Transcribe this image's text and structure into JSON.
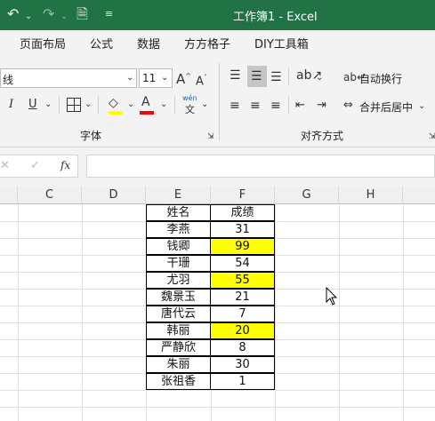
{
  "titlebar": {
    "title": "工作簿1  -  Excel",
    "undo_icon": "undo-icon",
    "redo_icon": "redo-icon",
    "more_icon": "customize-icon"
  },
  "tabs": [
    "页面布局",
    "公式",
    "数据",
    "方方格子",
    "DIY工具箱"
  ],
  "ribbon": {
    "font_name": "线",
    "font_size": "11",
    "font_group_label": "字体",
    "align_group_label": "对齐方式",
    "wrap_text": "自动换行",
    "merge_center": "合并后居中",
    "phonetic_top": "wén",
    "phonetic_bottom": "文",
    "grow_font": "A",
    "shrink_font": "A",
    "italic": "I",
    "underline": "U",
    "font_color_letter": "A",
    "highlight_color": "#ffff00",
    "font_color": "#ff0000"
  },
  "formula_bar": {
    "fx": "fx",
    "cancel": "✕",
    "enter": "✓",
    "value": ""
  },
  "columns": [
    "C",
    "D",
    "E",
    "F",
    "G",
    "H"
  ],
  "table": {
    "headers": [
      "姓名",
      "成绩"
    ],
    "rows": [
      {
        "name": "李燕",
        "score": "31",
        "highlight": false
      },
      {
        "name": "钱卿",
        "score": "99",
        "highlight": true
      },
      {
        "name": "干珊",
        "score": "54",
        "highlight": false
      },
      {
        "name": "尤羽",
        "score": "55",
        "highlight": true
      },
      {
        "name": "魏景玉",
        "score": "21",
        "highlight": false
      },
      {
        "name": "唐代云",
        "score": "7",
        "highlight": false
      },
      {
        "name": "韩丽",
        "score": "20",
        "highlight": true
      },
      {
        "name": "严静欣",
        "score": "8",
        "highlight": false
      },
      {
        "name": "朱丽",
        "score": "30",
        "highlight": false
      },
      {
        "name": "张祖香",
        "score": "1",
        "highlight": false
      }
    ]
  }
}
